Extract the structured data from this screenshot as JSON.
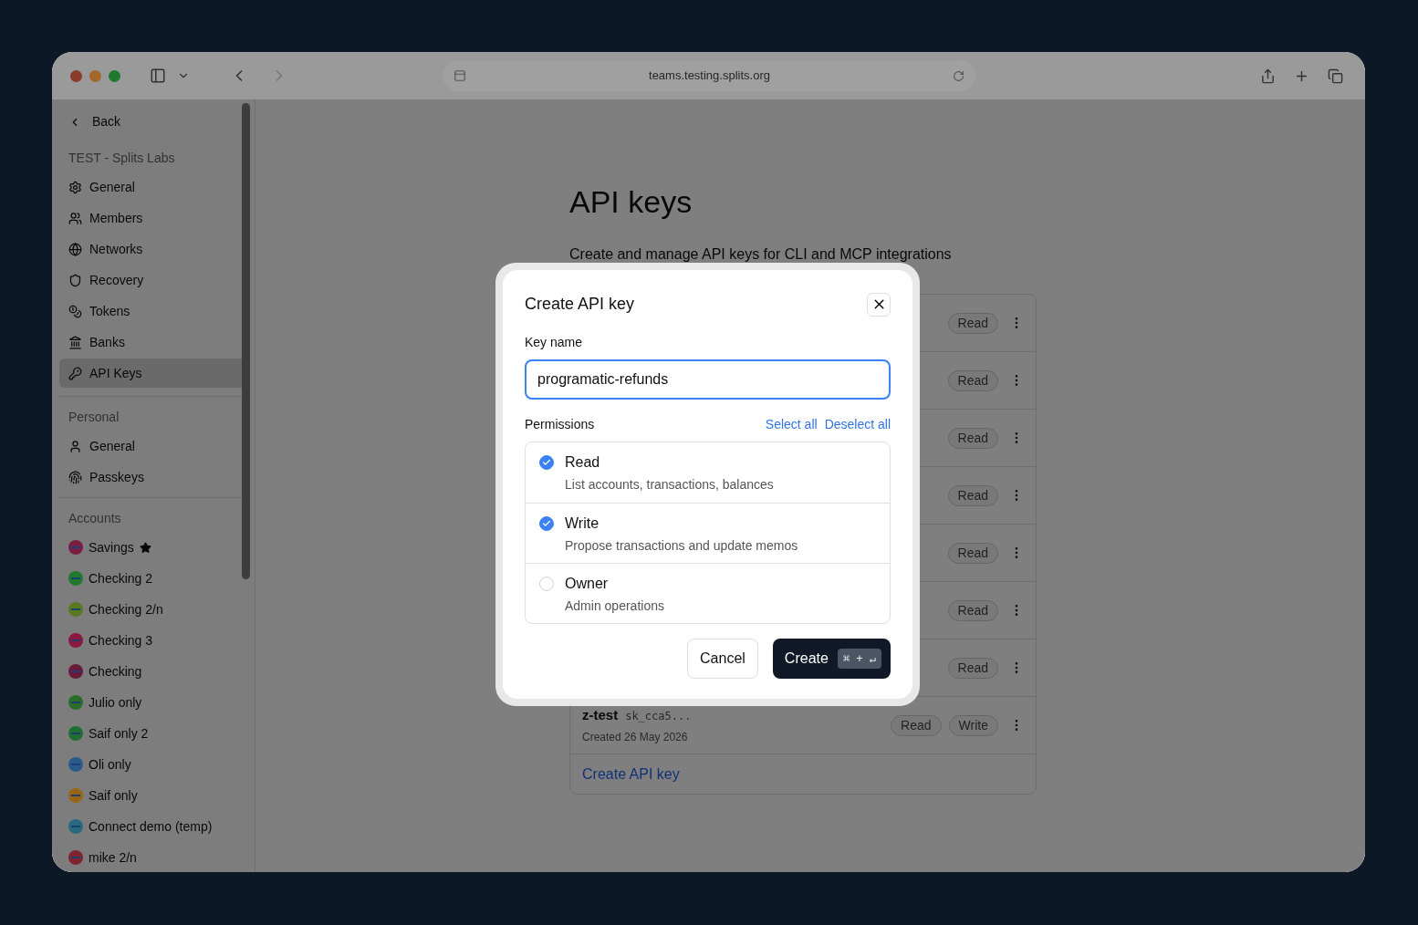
{
  "browser": {
    "url": "teams.testing.splits.org"
  },
  "sidebar": {
    "back": "Back",
    "sections": [
      {
        "title": "TEST - Splits Labs",
        "items": [
          {
            "label": "General",
            "selected": false
          },
          {
            "label": "Members",
            "selected": false
          },
          {
            "label": "Networks",
            "selected": false
          },
          {
            "label": "Recovery",
            "selected": false
          },
          {
            "label": "Tokens",
            "selected": false
          },
          {
            "label": "Banks",
            "selected": false
          },
          {
            "label": "API Keys",
            "selected": true
          }
        ]
      },
      {
        "title": "Personal",
        "items": [
          {
            "label": "General",
            "selected": false
          },
          {
            "label": "Passkeys",
            "selected": false
          }
        ]
      }
    ],
    "accounts_title": "Accounts",
    "accounts": [
      {
        "label": "Savings",
        "color": "#7a1f44",
        "starred": true
      },
      {
        "label": "Checking 2",
        "color": "#1f7a2e",
        "starred": false
      },
      {
        "label": "Checking 2/n",
        "color": "#5a7a20",
        "starred": false
      },
      {
        "label": "Checking 3",
        "color": "#8a1840",
        "starred": false
      },
      {
        "label": "Checking",
        "color": "#6a1a3a",
        "starred": false
      },
      {
        "label": "Julio only",
        "color": "#2a6e2a",
        "starred": false
      },
      {
        "label": "Saif only 2",
        "color": "#1f6e34",
        "starred": false
      },
      {
        "label": "Oli only",
        "color": "#2a5a8a",
        "starred": false
      },
      {
        "label": "Saif only",
        "color": "#9a6418",
        "starred": false
      },
      {
        "label": "Connect demo (temp)",
        "color": "#2a6a80",
        "starred": false
      },
      {
        "label": "mike 2/n",
        "color": "#7e2430",
        "starred": false
      }
    ]
  },
  "page": {
    "title": "API keys",
    "subtitle": "Create and manage API keys for CLI and MCP integrations",
    "keys": [
      {
        "badges": [
          "Read"
        ]
      },
      {
        "badges": [
          "Read"
        ]
      },
      {
        "badges": [
          "Read"
        ]
      },
      {
        "badges": [
          "Read"
        ]
      },
      {
        "badges": [
          "Read"
        ]
      },
      {
        "badges": [
          "Read"
        ]
      },
      {
        "badges": [
          "Read"
        ]
      },
      {
        "name": "z-test",
        "prefix": "sk_cca5...",
        "created": "Created 26 May 2026",
        "badges": [
          "Read",
          "Write"
        ]
      }
    ],
    "create_link": "Create API key"
  },
  "modal": {
    "title": "Create API key",
    "key_name_label": "Key name",
    "key_name_value": "programatic-refunds",
    "permissions_label": "Permissions",
    "select_all": "Select all",
    "deselect_all": "Deselect all",
    "permissions": [
      {
        "label": "Read",
        "description": "List accounts, transactions, balances",
        "checked": true
      },
      {
        "label": "Write",
        "description": "Propose transactions and update memos",
        "checked": true
      },
      {
        "label": "Owner",
        "description": "Admin operations",
        "checked": false
      }
    ],
    "cancel": "Cancel",
    "create": "Create",
    "shortcut": "⌘ + ↵"
  }
}
